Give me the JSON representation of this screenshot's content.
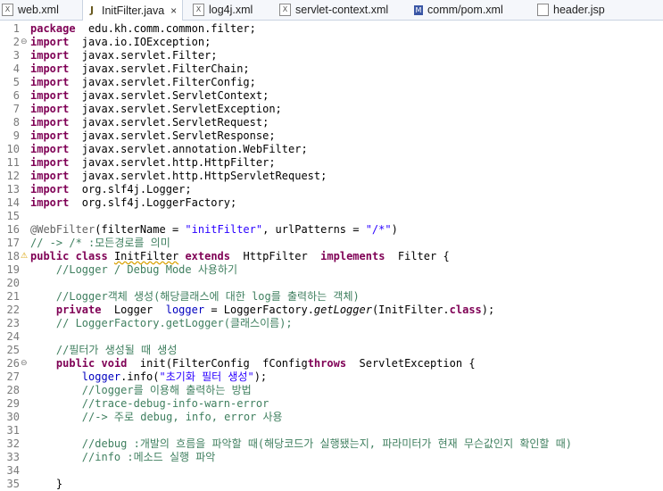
{
  "tabs": [
    {
      "label": "web.xml",
      "icon": "xml-file-icon",
      "active": false
    },
    {
      "label": "InitFilter.java",
      "icon": "java-file-icon",
      "active": true,
      "close": "×"
    },
    {
      "label": "log4j.xml",
      "icon": "xml-file-icon",
      "active": false
    },
    {
      "label": "servlet-context.xml",
      "icon": "xml-file-icon",
      "active": false
    },
    {
      "label": "comm/pom.xml",
      "icon": "maven-pom-icon",
      "active": false
    },
    {
      "label": "header.jsp",
      "icon": "jsp-file-icon",
      "active": false
    }
  ],
  "lines": [
    {
      "n": "1",
      "t": [
        [
          "kw",
          "package"
        ],
        [
          "",
          "  edu.kh.comm.common.filter;"
        ]
      ]
    },
    {
      "n": "2",
      "m": "⊖",
      "t": [
        [
          "kw",
          "import"
        ],
        [
          "",
          "  java.io.IOException;"
        ]
      ]
    },
    {
      "n": "3",
      "t": [
        [
          "kw",
          "import"
        ],
        [
          "",
          "  javax.servlet.Filter;"
        ]
      ]
    },
    {
      "n": "4",
      "t": [
        [
          "kw",
          "import"
        ],
        [
          "",
          "  javax.servlet.FilterChain;"
        ]
      ]
    },
    {
      "n": "5",
      "t": [
        [
          "kw",
          "import"
        ],
        [
          "",
          "  javax.servlet.FilterConfig;"
        ]
      ]
    },
    {
      "n": "6",
      "t": [
        [
          "kw",
          "import"
        ],
        [
          "",
          "  javax.servlet.ServletContext;"
        ]
      ]
    },
    {
      "n": "7",
      "t": [
        [
          "kw",
          "import"
        ],
        [
          "",
          "  javax.servlet.ServletException;"
        ]
      ]
    },
    {
      "n": "8",
      "t": [
        [
          "kw",
          "import"
        ],
        [
          "",
          "  javax.servlet.ServletRequest;"
        ]
      ]
    },
    {
      "n": "9",
      "t": [
        [
          "kw",
          "import"
        ],
        [
          "",
          "  javax.servlet.ServletResponse;"
        ]
      ]
    },
    {
      "n": "10",
      "t": [
        [
          "kw",
          "import"
        ],
        [
          "",
          "  javax.servlet.annotation.WebFilter;"
        ]
      ]
    },
    {
      "n": "11",
      "t": [
        [
          "kw",
          "import"
        ],
        [
          "",
          "  javax.servlet.http.HttpFilter;"
        ]
      ]
    },
    {
      "n": "12",
      "t": [
        [
          "kw",
          "import"
        ],
        [
          "",
          "  javax.servlet.http.HttpServletRequest;"
        ]
      ]
    },
    {
      "n": "13",
      "t": [
        [
          "kw",
          "import"
        ],
        [
          "",
          "  org.slf4j.Logger;"
        ]
      ]
    },
    {
      "n": "14",
      "t": [
        [
          "kw",
          "import"
        ],
        [
          "",
          "  org.slf4j.LoggerFactory;"
        ]
      ]
    },
    {
      "n": "15",
      "t": []
    },
    {
      "n": "16",
      "t": [
        [
          "ann",
          "@WebFilter"
        ],
        [
          "",
          "(filterName = "
        ],
        [
          "str",
          "\"initFilter\""
        ],
        [
          "",
          ", urlPatterns = "
        ],
        [
          "str",
          "\"/*\""
        ],
        [
          "",
          ")"
        ]
      ]
    },
    {
      "n": "17",
      "t": [
        [
          "cm",
          "// -> /* :모든경로를 의미"
        ]
      ]
    },
    {
      "n": "18",
      "m": "⚠",
      "mw": true,
      "t": [
        [
          "kw",
          "public"
        ],
        [
          "",
          " "
        ],
        [
          "kw",
          "class"
        ],
        [
          "",
          " "
        ],
        [
          "ulw",
          "InitFilter"
        ],
        [
          "",
          " "
        ],
        [
          "kw",
          "extends"
        ],
        [
          "",
          "  HttpFilter  "
        ],
        [
          "kw",
          "implements"
        ],
        [
          "",
          "  Filter {"
        ]
      ]
    },
    {
      "n": "19",
      "t": [
        [
          "",
          "    "
        ],
        [
          "cm",
          "//Logger / Debug Mode 사용하기"
        ]
      ]
    },
    {
      "n": "20",
      "t": []
    },
    {
      "n": "21",
      "t": [
        [
          "",
          "    "
        ],
        [
          "cm",
          "//Logger객체 생성(해당클래스에 대한 log를 출력하는 객체)"
        ]
      ]
    },
    {
      "n": "22",
      "t": [
        [
          "",
          "    "
        ],
        [
          "kw",
          "private"
        ],
        [
          "",
          "  Logger  "
        ],
        [
          "fld",
          "logger"
        ],
        [
          "",
          " = LoggerFactory."
        ],
        [
          "it",
          "getLogger"
        ],
        [
          "",
          "(InitFilter."
        ],
        [
          "kw",
          "class"
        ],
        [
          "",
          ");"
        ]
      ]
    },
    {
      "n": "23",
      "t": [
        [
          "",
          "    "
        ],
        [
          "cm",
          "// LoggerFactory.getLogger(클래스이름);"
        ]
      ]
    },
    {
      "n": "24",
      "t": []
    },
    {
      "n": "25",
      "t": [
        [
          "",
          "    "
        ],
        [
          "cm",
          "//필터가 생성될 때 생성"
        ]
      ]
    },
    {
      "n": "26",
      "m": "⊖",
      "t": [
        [
          "",
          "    "
        ],
        [
          "kw",
          "public"
        ],
        [
          "",
          " "
        ],
        [
          "kw",
          "void"
        ],
        [
          "",
          "  init(FilterConfig  "
        ],
        [
          "",
          "fConfig"
        ],
        [
          ") "
        ],
        [
          "kw",
          "throws"
        ],
        [
          "",
          "  ServletException {"
        ]
      ]
    },
    {
      "n": "27",
      "t": [
        [
          "",
          "        "
        ],
        [
          "fld",
          "logger"
        ],
        [
          "",
          ".info("
        ],
        [
          "str",
          "\"초기화 필터 생성\""
        ],
        [
          "",
          ");"
        ]
      ]
    },
    {
      "n": "28",
      "t": [
        [
          "",
          "        "
        ],
        [
          "cm",
          "//logger를 이용해 출력하는 방법"
        ]
      ]
    },
    {
      "n": "29",
      "t": [
        [
          "",
          "        "
        ],
        [
          "cm",
          "//trace-debug-info-warn-error"
        ]
      ]
    },
    {
      "n": "30",
      "t": [
        [
          "",
          "        "
        ],
        [
          "cm",
          "//-> 주로 debug, info, error 사용"
        ]
      ]
    },
    {
      "n": "31",
      "t": []
    },
    {
      "n": "32",
      "t": [
        [
          "",
          "        "
        ],
        [
          "cm",
          "//debug :개발의 흐름을 파악할 때(해당코드가 실행됐는지, 파라미터가 현재 무슨값인지 확인할 때)"
        ]
      ]
    },
    {
      "n": "33",
      "t": [
        [
          "",
          "        "
        ],
        [
          "cm",
          "//info :메소드 실행 파악"
        ]
      ]
    },
    {
      "n": "34",
      "t": []
    },
    {
      "n": "35",
      "t": [
        [
          "",
          "    }"
        ]
      ]
    }
  ]
}
